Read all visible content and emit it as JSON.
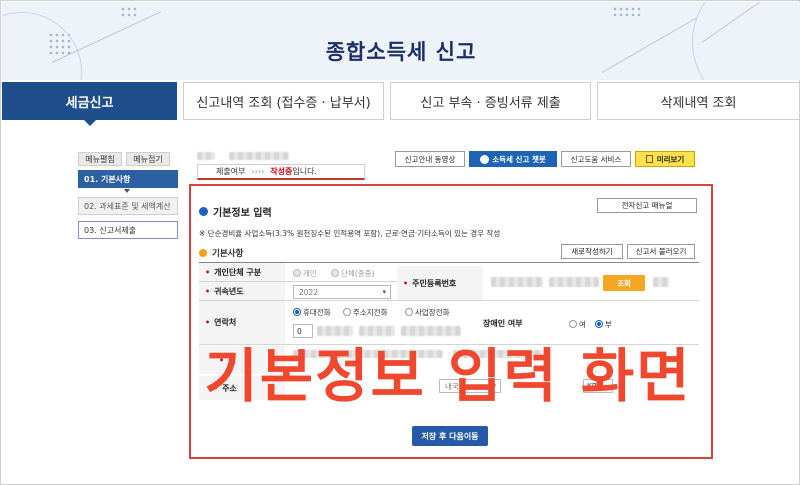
{
  "header": {
    "title": "종합소득세 신고"
  },
  "tabs": [
    {
      "label": "세금신고",
      "active": true
    },
    {
      "label": "신고내역 조회 (접수증 · 납부서)",
      "active": false
    },
    {
      "label": "신고 부속 · 증빙서류 제출",
      "active": false
    },
    {
      "label": "삭제내역 조회",
      "active": false
    }
  ],
  "left_menu": {
    "expand_label": "메뉴펼침",
    "collapse_label": "메뉴접기",
    "items": [
      {
        "label": "01. 기본사항",
        "state": "active"
      },
      {
        "label": "02. 과세표준 및 세액계산",
        "state": "disabled"
      },
      {
        "label": "03. 신고서제출",
        "state": "normal"
      }
    ]
  },
  "status": {
    "label": "제출여부",
    "arrows": "›››› ",
    "value": "작성중",
    "suffix": "입니다."
  },
  "toolbar": {
    "guide_video": "신고안내 동영상",
    "chatbot": "소득세 신고 챗봇",
    "help_service": "신고도움 서비스",
    "preview": "미리보기"
  },
  "panel": {
    "title": "기본정보 입력",
    "manual_button": "전자신고 매뉴얼",
    "note": "※ 단순경비율 사업소득(3.3% 원천징수된 인적용역 포함), 근로·연금·기타소득이 있는 경우 작성",
    "section": "기본사항",
    "new_write_button": "새로작성하기",
    "load_button": "신고서 불러오기",
    "fields": {
      "person_type_label": "개인단체 구분",
      "person_options": [
        "개인",
        "단체(종중)"
      ],
      "rrn_label": "주민등록번호",
      "lookup_button": "조회",
      "year_label": "귀속년도",
      "year_value": "2022",
      "contact_label": "연락처",
      "contact_options": [
        "휴대전화",
        "주소지전화",
        "사업장전화"
      ],
      "phone_prefix": "0",
      "disability_label": "장애인 여부",
      "disability_options": [
        "여",
        "부"
      ],
      "address_label": "소",
      "address2_label": "주소",
      "domestic_select": "내국인",
      "country_code": "KR"
    },
    "save_button": "저장 후 다음이동"
  },
  "overlay_caption": "기본정보 입력 화면"
}
